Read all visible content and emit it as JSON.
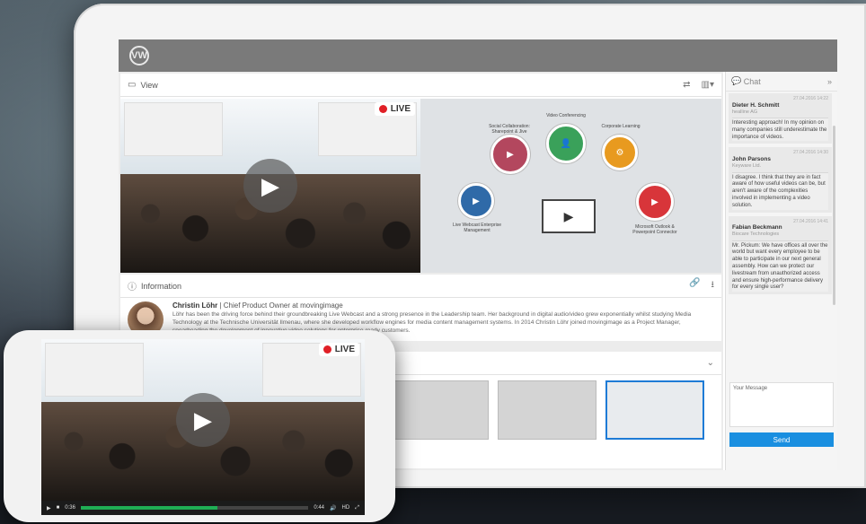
{
  "view_panel": {
    "title": "View"
  },
  "live_badge": "LIVE",
  "slide": {
    "labels": [
      "Social Collaboration: Sharepoint & Jive",
      "Video Conferencing",
      "Corporate Learning",
      "Live Webcast Enterprise Management",
      "Microsoft Outlook & Powerpoint Connector"
    ]
  },
  "information": {
    "title": "Information",
    "name": "Christin Löhr",
    "role": "| Chief Product Owner at movingimage",
    "bio": "Löhr has been the driving force behind their groundbreaking Live Webcast and a strong presence in the Leadership team. Her background in digital audio/video grew exponentially whilst studying Media Technology at the Technische Universität Ilmenau, where she developed workflow engines for media content management systems. In 2014 Christin Löhr joined movingimage as a Project Manager, spearheading the development of innovative video solutions for enterprise-ready customers."
  },
  "chat": {
    "title": "Chat",
    "messages": [
      {
        "time": "27.04.2016 14:22",
        "name": "Dieter H. Schmitt",
        "company": "healline AG",
        "text": "Interesting approach! In my opinion on many companies still underestimate the importance of videos."
      },
      {
        "time": "27.04.2016 14:30",
        "name": "John Parsons",
        "company": "Keyware Ltd.",
        "text": "I disagree. I think that they are in fact aware of how useful videos can be, but aren't aware of the complexities involved in implementing a video solution."
      },
      {
        "time": "27.04.2016 14:41",
        "name": "Fabian Beckmann",
        "company": "Biocare Technologies",
        "text": "Mr. Pickum: We have offices all over the world but want every employee to be able to participate in our next general assembly. How can we protect our livestream from unauthorized access and ensure high-performance delivery for every single user?"
      }
    ],
    "compose_placeholder": "Your Message",
    "send_label": "Send"
  },
  "phone_player": {
    "elapsed": "0:36",
    "total": "0:44",
    "quality": "HD",
    "progress": 0.6
  }
}
